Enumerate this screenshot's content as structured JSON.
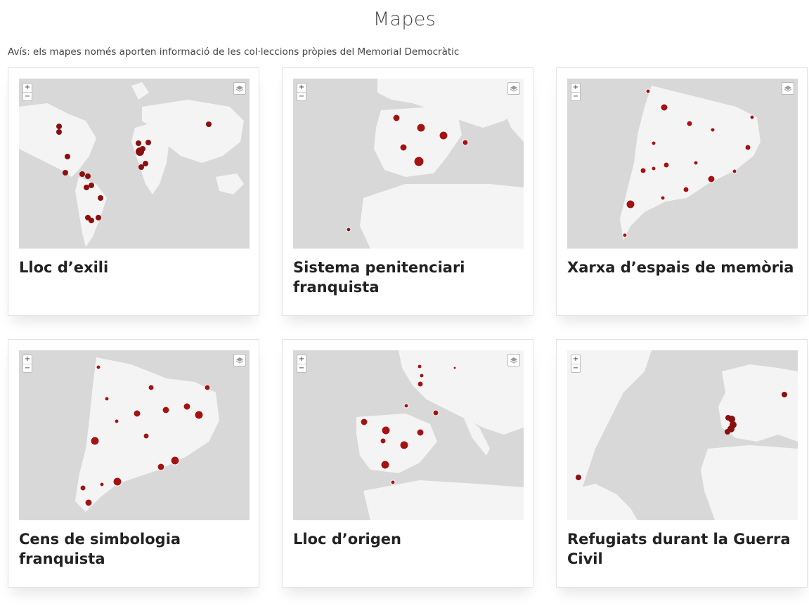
{
  "page": {
    "title": "Mapes",
    "notice": "Avís: els mapes només aporten informació de les col·leccions pròpies del Memorial Democràtic"
  },
  "controls": {
    "zoom_in": "+",
    "zoom_out": "−"
  },
  "cards": [
    {
      "title": "Lloc d’exili"
    },
    {
      "title": "Sistema penitenciari franquista"
    },
    {
      "title": "Xarxa d’espais de memòria"
    },
    {
      "title": "Cens de simbologia franquista"
    },
    {
      "title": "Lloc d’origen"
    },
    {
      "title": "Refugiats durant la Guerra Civil"
    }
  ],
  "colors": {
    "marker": "#9b1111",
    "land": "#f4f4f4",
    "water": "#d4d4d4",
    "card_border": "#e3e3e3"
  }
}
